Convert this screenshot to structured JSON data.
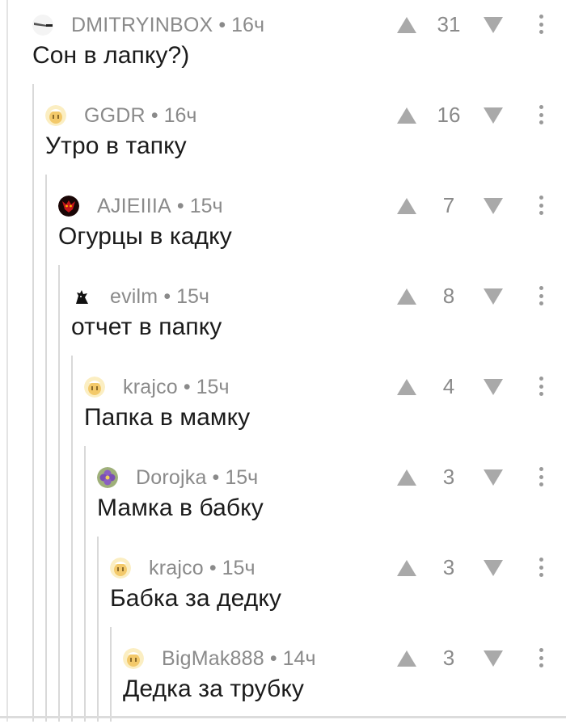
{
  "comments": [
    {
      "author": "DMITRYINBOX",
      "time": "16ч",
      "text": "Сон в лапку?)",
      "score": "31",
      "avatar": "knife-avatar"
    },
    {
      "author": "GGDR",
      "time": "16ч",
      "text": "Утро в тапку",
      "score": "16",
      "avatar": "default-avatar"
    },
    {
      "author": "AJIEIIIA",
      "time": "15ч",
      "text": "Огурцы в кадку",
      "score": "7",
      "avatar": "red-demon-avatar"
    },
    {
      "author": "evilm",
      "time": "15ч",
      "text": "отчет в папку",
      "score": "8",
      "avatar": "black-figure-avatar"
    },
    {
      "author": "krajco",
      "time": "15ч",
      "text": "Папка в мамку",
      "score": "4",
      "avatar": "default-avatar"
    },
    {
      "author": "Dorojka",
      "time": "15ч",
      "text": "Мамка в бабку",
      "score": "3",
      "avatar": "flower-avatar"
    },
    {
      "author": "krajco",
      "time": "15ч",
      "text": "Бабка за дедку",
      "score": "3",
      "avatar": "default-avatar"
    },
    {
      "author": "BigMak888",
      "time": "14ч",
      "text": "Дедка за трубку",
      "score": "3",
      "avatar": "default-avatar"
    }
  ],
  "separator": "•",
  "colors": {
    "meta": "#8a8a8a",
    "text": "#1b1b1b",
    "rail": "#d9d9d9",
    "avatar_default": "#f3d98a"
  }
}
